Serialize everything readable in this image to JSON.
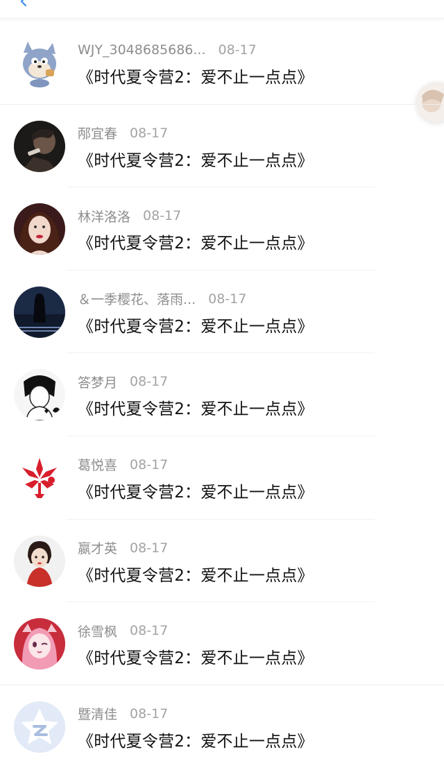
{
  "header": {
    "back_icon": "chevron-left-icon"
  },
  "accent_color": "#3d8ef0",
  "conversations": [
    {
      "name": "WJY_3048685686...",
      "date": "08-17",
      "message": "《时代夏令营2：爱不止一点点》",
      "avatar": "cartoon-cat"
    },
    {
      "name": "邴宜春",
      "date": "08-17",
      "message": "《时代夏令营2：爱不止一点点》",
      "avatar": "dark-photo"
    },
    {
      "name": "林洋洛洛",
      "date": "08-17",
      "message": "《时代夏令营2：爱不止一点点》",
      "avatar": "girl-red-lips"
    },
    {
      "name": "＆一季樱花、落雨...",
      "date": "08-17",
      "message": "《时代夏令营2：爱不止一点点》",
      "avatar": "night-scene"
    },
    {
      "name": "答梦月",
      "date": "08-17",
      "message": "《时代夏令营2：爱不止一点点》",
      "avatar": "line-art-girl"
    },
    {
      "name": "葛悦喜",
      "date": "08-17",
      "message": "《时代夏令营2：爱不止一点点》",
      "avatar": "red-paper-cut"
    },
    {
      "name": "嬴才英",
      "date": "08-17",
      "message": "《时代夏令营2：爱不止一点点》",
      "avatar": "illustrated-girl"
    },
    {
      "name": "徐雪枫",
      "date": "08-17",
      "message": "《时代夏令营2：爱不止一点点》",
      "avatar": "pink-anime-girl"
    },
    {
      "name": "暨清佳",
      "date": "08-17",
      "message": "《时代夏令营2：爱不止一点点》",
      "avatar": "default-star"
    }
  ]
}
